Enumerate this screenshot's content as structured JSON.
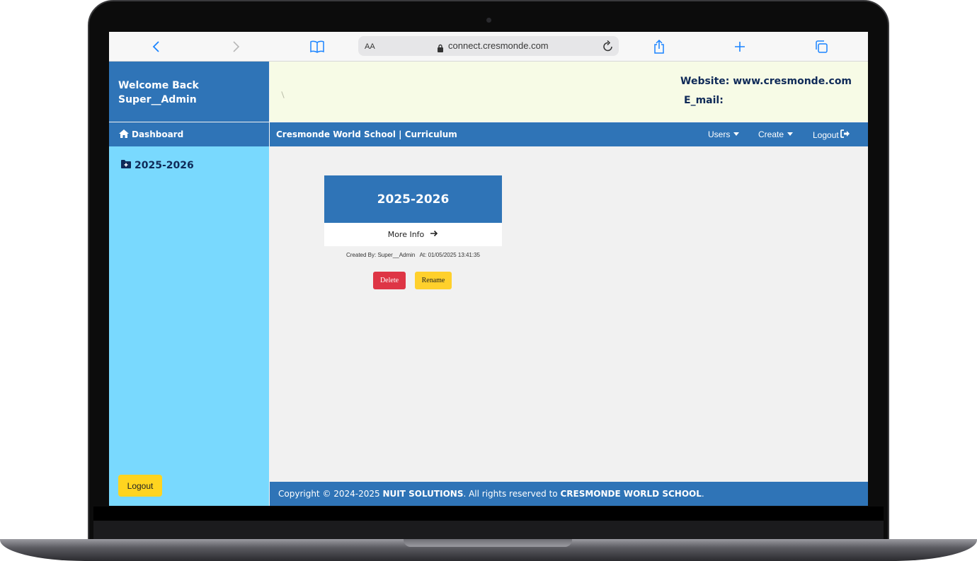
{
  "browser": {
    "url_size_label": "AA",
    "url": "connect.cresmonde.com"
  },
  "sidebar": {
    "welcome_line1": "Welcome Back",
    "welcome_line2": "Super__Admin",
    "dashboard_label": "Dashboard",
    "items": [
      {
        "label": "2025-2026"
      }
    ],
    "logout_label": "Logout"
  },
  "header": {
    "website": "Website: www.cresmonde.com",
    "email": "E_mail:"
  },
  "navbar": {
    "title": "Cresmonde World School | Curriculum",
    "users_label": "Users",
    "create_label": "Create",
    "logout_label": "Logout"
  },
  "card": {
    "title": "2025-2026",
    "more_info_label": "More Info",
    "meta": "Created By: Super__Admin   At: 01/05/2025 13:41:35",
    "delete_label": "Delete",
    "rename_label": "Rename"
  },
  "footer": {
    "prefix": "Copyright © 2024-2025 ",
    "company": "NUIT SOLUTIONS",
    "middle": ". All rights reserved to ",
    "school": "CRESMONDE WORLD SCHOOL",
    "suffix": "."
  },
  "colors": {
    "primary_blue": "#2f74b7",
    "sidebar_cyan": "#79d9fe",
    "banner_cream": "#f7fbe6",
    "delete_red": "#de3545",
    "rename_yellow": "#ffd02c"
  }
}
